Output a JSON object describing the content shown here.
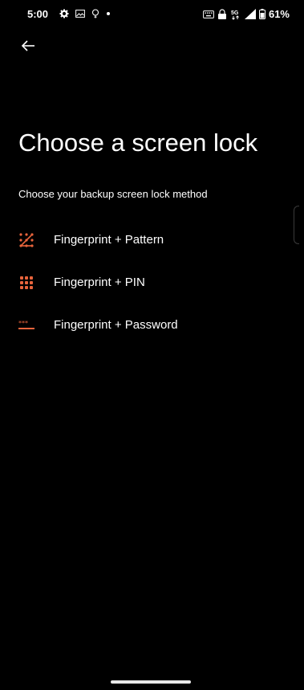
{
  "status_bar": {
    "time": "5:00",
    "left_icons": [
      "gear-icon",
      "gallery-icon",
      "bulb-icon",
      "dot-icon"
    ],
    "right_icons": [
      "keyboard-icon",
      "vpn-icon",
      "5g-icon",
      "signal-icon",
      "battery-icon"
    ],
    "network_label": "5G",
    "battery": "61%"
  },
  "header": {
    "back_icon": "arrow-left-icon",
    "title": "Choose a screen lock",
    "subtitle": "Choose your backup screen lock method"
  },
  "options": [
    {
      "label": "Fingerprint + Pattern",
      "icon": "pattern-icon"
    },
    {
      "label": "Fingerprint + PIN",
      "icon": "pin-icon"
    },
    {
      "label": "Fingerprint + Password",
      "icon": "password-icon"
    }
  ],
  "colors": {
    "accent": "#e8643c",
    "background": "#000000",
    "text": "#ffffff"
  }
}
